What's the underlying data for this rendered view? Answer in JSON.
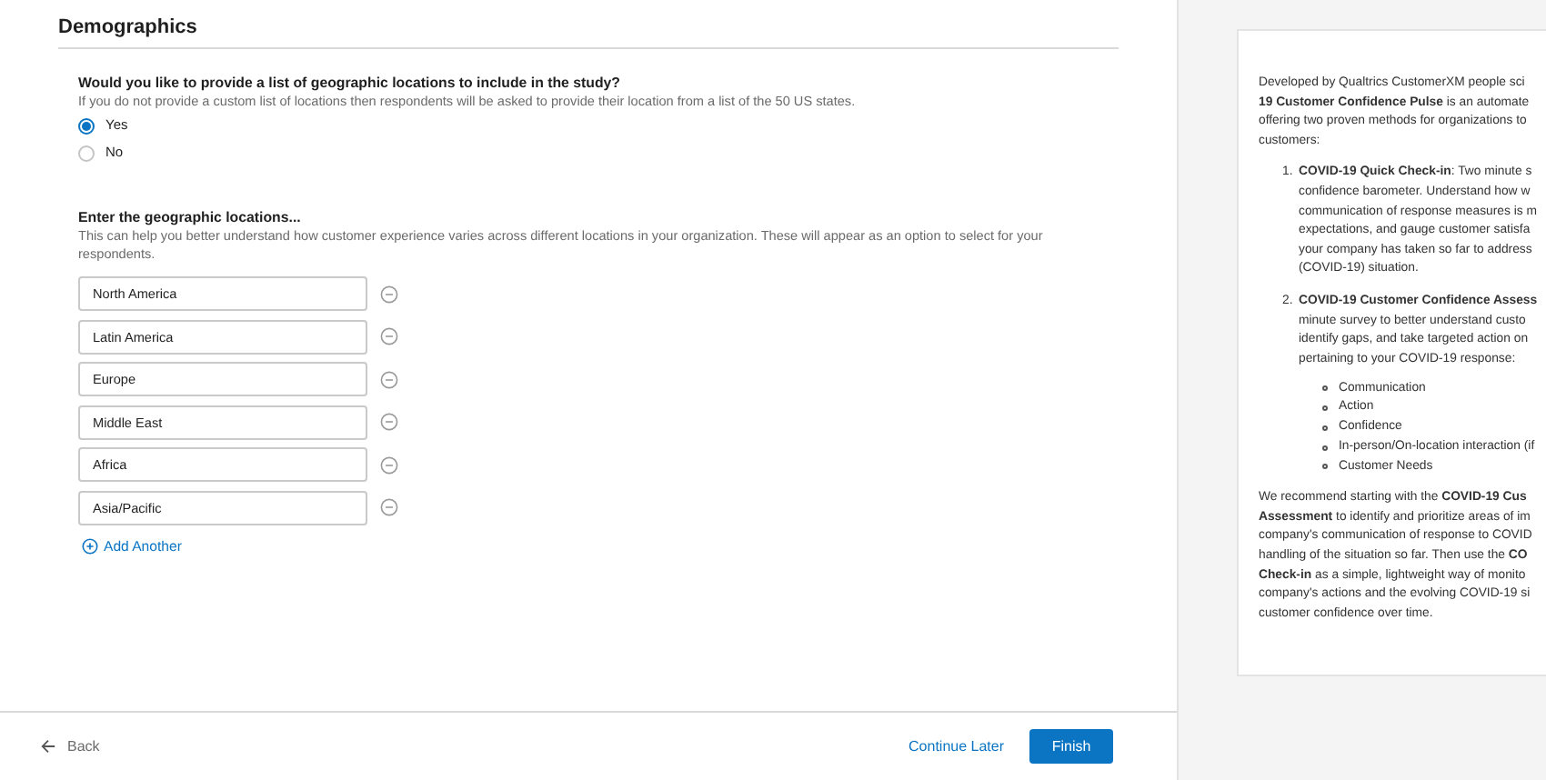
{
  "header": {
    "title": "Demographics"
  },
  "question": {
    "title": "Would you like to provide a list of geographic locations to include in the study?",
    "description": "If you do not provide a custom list of locations then respondents will be asked to provide their location from a list of the 50 US states.",
    "options": [
      {
        "label": "Yes",
        "selected": true
      },
      {
        "label": "No",
        "selected": false
      }
    ]
  },
  "locations": {
    "title": "Enter the geographic locations...",
    "description": "This can help you better understand how customer experience varies across different locations in your organization. These will appear as an option to select for your respondents.",
    "items": [
      {
        "value": "North America"
      },
      {
        "value": "Latin America"
      },
      {
        "value": "Europe"
      },
      {
        "value": "Middle East"
      },
      {
        "value": "Africa"
      },
      {
        "value": "Asia/Pacific"
      }
    ],
    "add_label": "Add Another"
  },
  "footer": {
    "back": "Back",
    "continue_later": "Continue Later",
    "finish": "Finish"
  },
  "side_panel": {
    "intro": [
      "Developed by Qualtrics CustomerXM people sci",
      "**19 Customer Confidence Pulse** is an automate",
      "offering two proven methods for organizations to",
      "customers:"
    ],
    "steps": [
      {
        "number": "1.",
        "lines": [
          "**COVID-19 Quick Check-in**: Two minute s",
          "confidence barometer. Understand how w",
          "communication of response measures is m",
          "expectations, and gauge customer satisfa",
          "your company has taken so far to address",
          "(COVID-19) situation."
        ]
      },
      {
        "number": "2.",
        "lines": [
          "**COVID-19 Customer Confidence Assess**",
          "minute survey to better understand custo",
          "identify gaps, and take targeted action on",
          "pertaining to your COVID-19 response:"
        ],
        "bullets": [
          "Communication",
          "Action",
          "Confidence",
          "In-person/On-location interaction (if",
          "Customer Needs"
        ]
      }
    ],
    "recommendation": [
      "We recommend starting with the **COVID-19 Cus**",
      "**Assessment** to identify and prioritize areas of im",
      "company's communication of response to COVID",
      "handling of the situation so far. Then use the **CO**",
      "**Check-in** as a simple, lightweight way of monito",
      "company's actions and the evolving COVID-19 si",
      "customer confidence over time."
    ]
  }
}
